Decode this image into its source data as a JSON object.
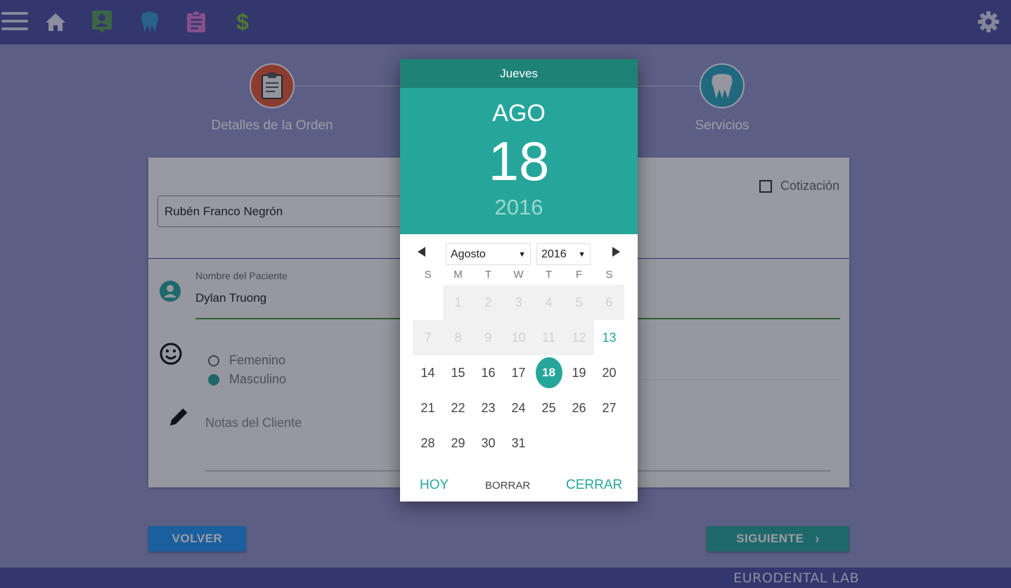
{
  "app": {
    "brand": "EURODENTAL LAB"
  },
  "colors": {
    "primary": "#4a52a0",
    "accent": "#26a69a",
    "accent_dark": "#1f8277",
    "back_button": "#2196f3"
  },
  "steps": [
    {
      "label": "Detalles de la Orden",
      "icon": "clipboard-icon",
      "color": "#e35a35"
    },
    {
      "label": "Servicios",
      "icon": "tooth-icon",
      "color": "#29a5bc"
    }
  ],
  "order": {
    "lab_client": "Rubén Franco Negrón",
    "quote_label": "Cotización",
    "patient_label": "Nombre del Paciente",
    "patient_value": "Dylan Truong",
    "gender_options": [
      "Femenino",
      "Masculino"
    ],
    "gender_selected": "Masculino",
    "notes_placeholder": "Notas del Cliente"
  },
  "buttons": {
    "back": "VOLVER",
    "next": "SIGUIENTE"
  },
  "datepicker": {
    "weekday": "Jueves",
    "month_short": "AGO",
    "day": "18",
    "year": "2016",
    "month_select": "Agosto",
    "year_select": "2016",
    "weekday_headers": [
      "S",
      "M",
      "T",
      "W",
      "T",
      "F",
      "S"
    ],
    "weeks": [
      [
        "",
        "1",
        "2",
        "3",
        "4",
        "5",
        "6"
      ],
      [
        "7",
        "8",
        "9",
        "10",
        "11",
        "12",
        "13"
      ],
      [
        "14",
        "15",
        "16",
        "17",
        "18",
        "19",
        "20"
      ],
      [
        "21",
        "22",
        "23",
        "24",
        "25",
        "26",
        "27"
      ],
      [
        "28",
        "29",
        "30",
        "31",
        "",
        "",
        ""
      ]
    ],
    "today": "13",
    "selected": "18",
    "actions": {
      "today": "HOY",
      "clear": "BORRAR",
      "close": "CERRAR"
    }
  }
}
